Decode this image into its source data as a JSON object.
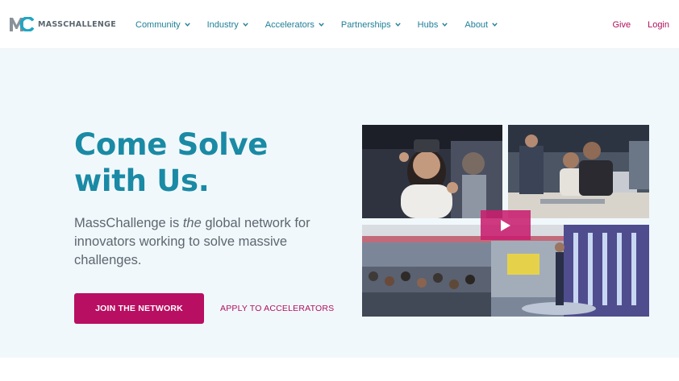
{
  "brand": {
    "logo_monogram": "MC",
    "name": "MASSCHALLENGE",
    "colors": {
      "teal": "#1a8aa5",
      "magenta": "#b80f62",
      "gray": "#5a6670"
    }
  },
  "nav": {
    "items": [
      {
        "label": "Community"
      },
      {
        "label": "Industry"
      },
      {
        "label": "Accelerators"
      },
      {
        "label": "Partnerships"
      },
      {
        "label": "Hubs"
      },
      {
        "label": "About"
      }
    ],
    "give_label": "Give",
    "login_label": "Login"
  },
  "hero": {
    "headline_line1": "Come Solve",
    "headline_line2": "with Us.",
    "subcopy_before": "MassChallenge is ",
    "subcopy_emphasis": "the",
    "subcopy_after": " global network for innovators working to solve massive challenges.",
    "cta_primary": "JOIN THE NETWORK",
    "cta_secondary": "APPLY TO ACCELERATORS"
  },
  "media": {
    "photos": [
      {
        "icon": "photo-vr-headset"
      },
      {
        "icon": "photo-demo-table"
      },
      {
        "icon": "photo-event-stage"
      }
    ],
    "play_icon": "play-icon"
  }
}
